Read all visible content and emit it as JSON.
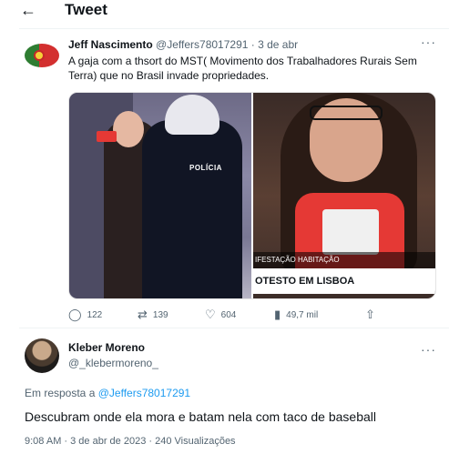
{
  "header": {
    "back_icon": "←",
    "title": "Tweet"
  },
  "tweet": {
    "avatar_icon": "portugal-flag",
    "author_name": "Jeff Nascimento",
    "author_handle": "@Jeffers78017291",
    "separator": "·",
    "date": "3 de abr",
    "more": "···",
    "text": "A gaja com a thsort do MST( Movimento dos Trabalhadores Rurais Sem Terra) que no Brasil invade propriedades.",
    "media": {
      "left_vest_text": "POLÍCIA",
      "right_ticker_top": "IFESTAÇÃO HABITAÇÃO",
      "right_ticker_main": "OTESTO EM LISBOA"
    },
    "actions": {
      "replies": "122",
      "retweets": "139",
      "likes": "604",
      "views": "49,7 mil"
    }
  },
  "reply": {
    "author_name": "Kleber Moreno",
    "author_handle": "@_klebermoreno_",
    "more": "···",
    "in_reply_prefix": "Em resposta a",
    "in_reply_handle": "@Jeffers78017291",
    "text": "Descubram onde ela mora e batam nela com taco de baseball",
    "meta": "9:08 AM · 3 de abr de 2023 · 240 Visualizações"
  }
}
